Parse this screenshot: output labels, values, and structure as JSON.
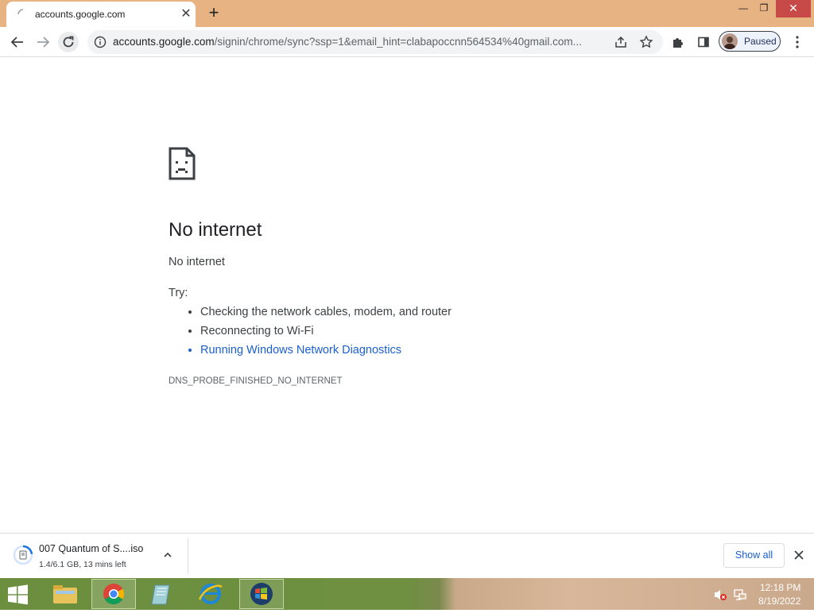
{
  "colors": {
    "tabstrip": "#e8b383",
    "link": "#1a5fcf",
    "text_primary": "#202124",
    "text_secondary": "#3c4043",
    "close_red": "#c74a48"
  },
  "tab": {
    "title": "accounts.google.com",
    "favicon": "loading-favicon-icon",
    "close_icon": "close-icon",
    "new_tab_icon": "plus-icon"
  },
  "window_controls": {
    "minimize": "—",
    "restore": "❐",
    "close": "✕"
  },
  "toolbar": {
    "url_host": "accounts.google.com",
    "url_path": "/signin/chrome/sync?ssp=1&email_hint=clabapoccnn564534%40gmail.com...",
    "profile_label": "Paused"
  },
  "error_page": {
    "title": "No internet",
    "subtitle": "No internet",
    "try_label": "Try:",
    "suggestions": [
      "Checking the network cables, modem, and router",
      "Reconnecting to Wi-Fi",
      "Running Windows Network Diagnostics"
    ],
    "error_code": "DNS_PROBE_FINISHED_NO_INTERNET"
  },
  "download_shelf": {
    "file_name": "007 Quantum of S....iso",
    "status": "1.4/6.1 GB, 13 mins left",
    "progress": 0.23,
    "show_all_label": "Show all"
  },
  "taskbar": {
    "apps": [
      "file-explorer-icon",
      "chrome-icon",
      "notepad-icon",
      "internet-explorer-icon",
      "windows7-icon"
    ],
    "clock_time": "12:18 PM",
    "clock_date": "8/19/2022"
  }
}
